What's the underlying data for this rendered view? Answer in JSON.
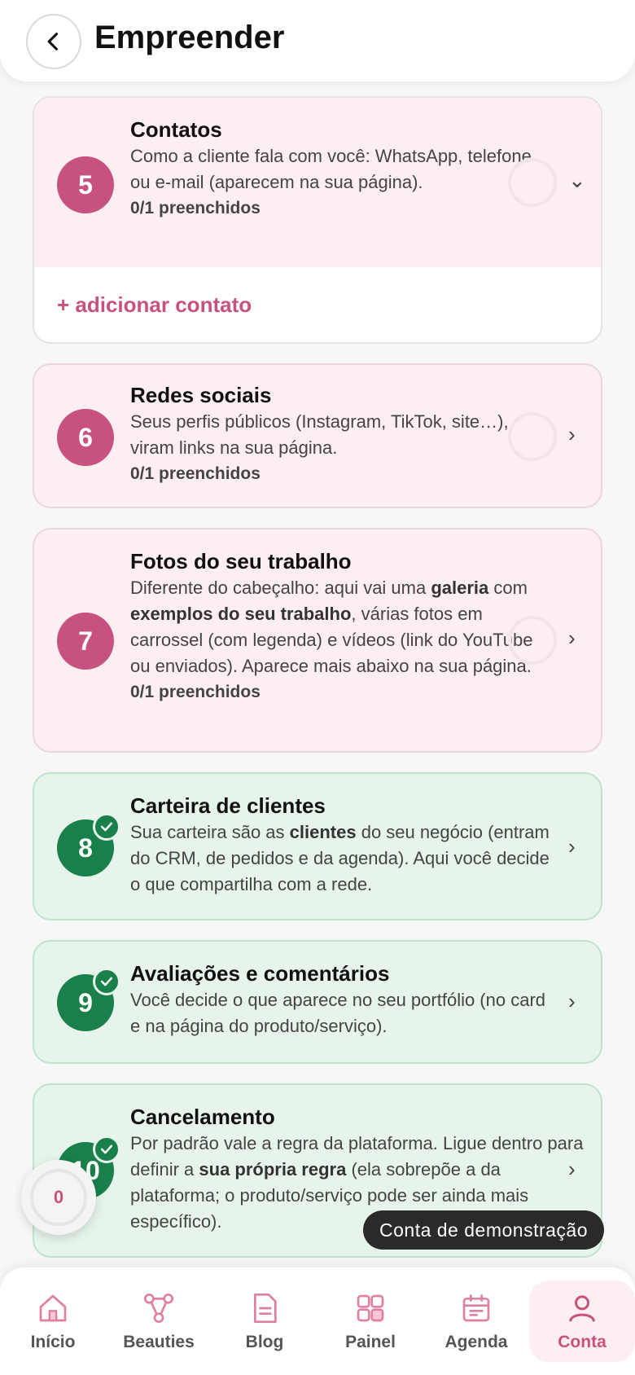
{
  "header": {
    "title": "Empreender",
    "back_icon": "chevron-left-icon"
  },
  "colors": {
    "accent": "#c8527f",
    "success": "#19804a",
    "pink_card": "#fdeef2",
    "green_card": "#e6f4ec"
  },
  "cards": [
    {
      "number": "5",
      "title": "Contatos",
      "description": "Como a cliente fala com você: WhatsApp, telefone ou e-mail (aparecem na sua página).",
      "filled": "0/1 preenchidos",
      "chevron": "⌄",
      "add_label": "+ adicionar contato"
    },
    {
      "number": "6",
      "title": "Redes sociais",
      "description": "Seus perfis públicos (Instagram, TikTok, site…), viram links na sua página.",
      "filled": "0/1 preenchidos",
      "chevron": "›"
    },
    {
      "number": "7",
      "title": "Fotos do seu trabalho",
      "desc_parts": [
        "Diferente do cabeçalho: aqui vai uma ",
        "galeria",
        " com ",
        "exemplos do seu trabalho",
        ", várias fotos em carrossel (com legenda) e vídeos (link do YouTube ou enviados). Aparece mais abaixo na sua página."
      ],
      "filled": "0/1 preenchidos",
      "chevron": "›"
    },
    {
      "number": "8",
      "title": "Carteira de clientes",
      "desc_parts": [
        "Sua carteira são as ",
        "clientes",
        " do seu negócio (entram do CRM, de pedidos e da agenda). Aqui você decide o que compartilha com a rede."
      ],
      "chevron": "›"
    },
    {
      "number": "9",
      "title": "Avaliações e comentários",
      "description": "Você decide o que aparece no seu portfólio (no card e na página do produto/serviço).",
      "chevron": "›"
    },
    {
      "number": "10",
      "title": "Cancelamento",
      "desc_parts": [
        "Por padrão vale a regra da plataforma. Ligue dentro para definir a ",
        "sua própria regra",
        " (ela sobrepõe a da plataforma; o produto/serviço pode ser ainda mais específico)."
      ],
      "chevron": "›"
    }
  ],
  "floating": {
    "count": "0"
  },
  "demo_badge": "Conta de demonstração",
  "nav": [
    {
      "label": "Início",
      "icon": "home-icon"
    },
    {
      "label": "Beauties",
      "icon": "network-icon"
    },
    {
      "label": "Blog",
      "icon": "document-icon"
    },
    {
      "label": "Painel",
      "icon": "grid-icon"
    },
    {
      "label": "Agenda",
      "icon": "calendar-icon"
    },
    {
      "label": "Conta",
      "icon": "user-icon",
      "active": true
    }
  ]
}
